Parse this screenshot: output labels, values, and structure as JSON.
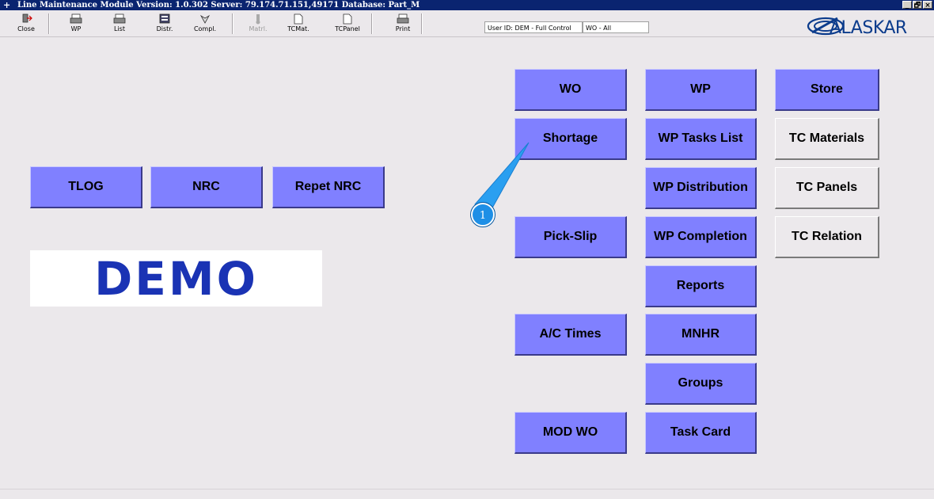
{
  "window": {
    "title": "Line Maintenance Module  Version: 1.0.302 Server: 79.174.71.151,49171 Database: Part_M",
    "controls": [
      "_",
      "🗗",
      "×"
    ]
  },
  "toolbar": {
    "tools": [
      {
        "label": "Close",
        "icon": "exit-icon",
        "enabled": true
      },
      {
        "label": "WP",
        "icon": "printer-icon",
        "enabled": true
      },
      {
        "label": "List",
        "icon": "printer-icon",
        "enabled": true
      },
      {
        "label": "Distr.",
        "icon": "distribution-icon",
        "enabled": true
      },
      {
        "label": "Compl.",
        "icon": "completion-icon",
        "enabled": true
      },
      {
        "label": "Matrl.",
        "icon": "material-icon",
        "enabled": false
      },
      {
        "label": "TCMat.",
        "icon": "document-icon",
        "enabled": true
      },
      {
        "label": "TCPanel",
        "icon": "document-icon",
        "enabled": true
      },
      {
        "label": "Print",
        "icon": "printer-icon",
        "enabled": true
      }
    ],
    "user_id": "User ID: DEM - Full Control",
    "wo_filter": "WO - All"
  },
  "brand": {
    "logo_text": "ALASKAR"
  },
  "left_buttons": {
    "tlog": "TLOG",
    "nrc": "NRC",
    "repet_nrc": "Repet NRC"
  },
  "demo_label": "DEMO",
  "column1": {
    "wo": "WO",
    "shortage": "Shortage",
    "pick_slip": "Pick-Slip",
    "ac_times": "A/C Times",
    "mod_wo": "MOD WO"
  },
  "column2": {
    "wp": "WP",
    "wp_tasks_list": "WP Tasks List",
    "wp_distribution": "WP Distribution",
    "wp_completion": "WP Completion",
    "reports": "Reports",
    "mnhr": "MNHR",
    "groups": "Groups",
    "task_card": "Task Card"
  },
  "column3": {
    "store": "Store",
    "tc_materials": "TC Materials",
    "tc_panels": "TC Panels",
    "tc_relation": "TC Relation"
  },
  "callout": {
    "number": "1"
  },
  "colors": {
    "accent_button": "#8080ff",
    "title_bar": "#0a2470",
    "demo_text": "#1a33b4",
    "callout": "#1e8fe6"
  }
}
